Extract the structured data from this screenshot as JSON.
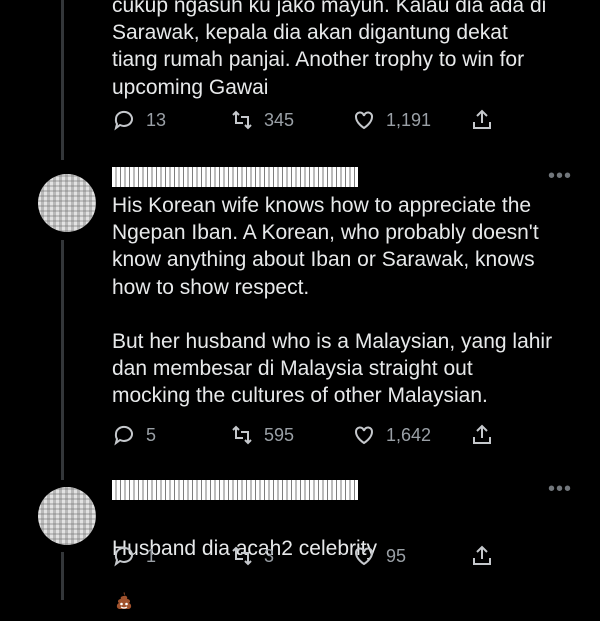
{
  "tweets": [
    {
      "text": "cukup ngasuh ku jako mayuh. Kalau dia ada di\nSarawak, kepala dia akan digantung dekat\ntiang rumah panjai. Another trophy to win for\nupcoming Gawai",
      "replies": "13",
      "retweets": "345",
      "likes": "1,191"
    },
    {
      "text": "His Korean wife knows how to appreciate the\nNgepan Iban. A Korean, who probably doesn't\nknow anything about Iban or Sarawak, knows\nhow to show respect.\n\nBut her husband who is a Malaysian, yang lahir\ndan membesar di Malaysia straight out\nmocking the cultures of other Malaysian.",
      "replies": "5",
      "retweets": "595",
      "likes": "1,642",
      "more": "•••"
    },
    {
      "text": "Husband dia acah2 celebrity",
      "emoji": "pile-of-poo",
      "replies": "1",
      "retweets": "3",
      "likes": "95",
      "more": "•••"
    }
  ],
  "icons": [
    "reply-icon",
    "retweet-icon",
    "like-icon",
    "share-icon"
  ],
  "colors": {
    "background": "#000000",
    "text": "#e7e9ea",
    "muted": "#71767b"
  }
}
